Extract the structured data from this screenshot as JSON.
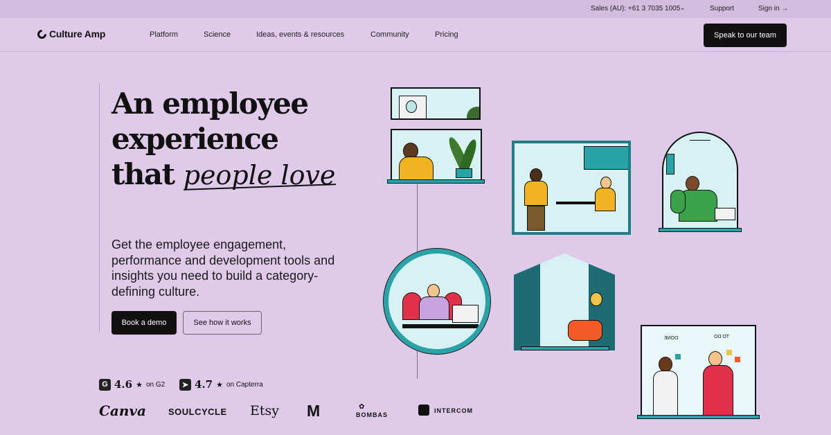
{
  "utility": {
    "sales": "Sales (AU): +61 3 7035 1005",
    "support": "Support",
    "signin": "Sign in →"
  },
  "nav": {
    "brand": "Culture Amp",
    "links": [
      "Platform",
      "Science",
      "Ideas, events & resources",
      "Community",
      "Pricing"
    ],
    "cta": "Speak to our team"
  },
  "hero": {
    "headline_line1": "An employee",
    "headline_line2": "experience",
    "headline_line3_a": "that",
    "headline_line3_b": "people love",
    "subheadline": "Get the employee engagement, performance and development tools and insights you need to build a category-defining culture.",
    "primary_button": "Book a demo",
    "secondary_button": "See how it works"
  },
  "ratings": [
    {
      "badge": "G",
      "score": "4.6",
      "star": "★",
      "source": "on G2"
    },
    {
      "badge": "➤",
      "score": "4.7",
      "star": "★",
      "source": "on Capterra"
    }
  ],
  "customer_logos": [
    "Canva",
    "SOULCYCLE",
    "Etsy",
    "M",
    "BOMBAS",
    "INTERCOM"
  ],
  "illustration": {
    "board_left": "DONE",
    "board_right": "TO DO"
  },
  "colors": {
    "background": "#e0caea",
    "utility_bar": "#d2bcdf",
    "accent_teal": "#2aa3a8",
    "dark": "#111111"
  }
}
